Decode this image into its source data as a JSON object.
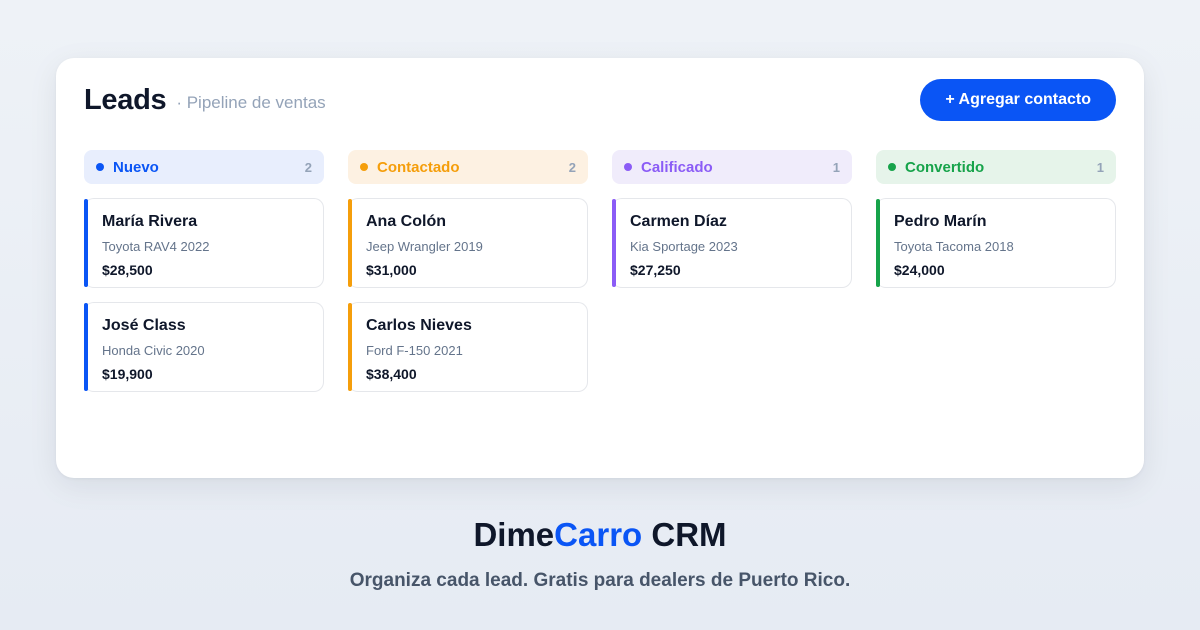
{
  "header": {
    "title": "Leads",
    "subtitle": "· Pipeline de ventas",
    "add_button_label": "+ Agregar contacto"
  },
  "columns": [
    {
      "label": "Nuevo",
      "count": "2",
      "color": "#0a55f5",
      "bg": "#e8eefd",
      "cards": [
        {
          "name": "María Rivera",
          "car": "Toyota RAV4 2022",
          "price": "$28,500"
        },
        {
          "name": "José Class",
          "car": "Honda Civic 2020",
          "price": "$19,900"
        }
      ]
    },
    {
      "label": "Contactado",
      "count": "2",
      "color": "#f59e0b",
      "bg": "#fdf1e2",
      "cards": [
        {
          "name": "Ana Colón",
          "car": "Jeep Wrangler 2019",
          "price": "$31,000"
        },
        {
          "name": "Carlos Nieves",
          "car": "Ford F-150 2021",
          "price": "$38,400"
        }
      ]
    },
    {
      "label": "Calificado",
      "count": "1",
      "color": "#8b5cf6",
      "bg": "#f0ecfb",
      "cards": [
        {
          "name": "Carmen Díaz",
          "car": "Kia Sportage 2023",
          "price": "$27,250"
        }
      ]
    },
    {
      "label": "Convertido",
      "count": "1",
      "color": "#16a34a",
      "bg": "#e6f4ea",
      "cards": [
        {
          "name": "Pedro Marín",
          "car": "Toyota Tacoma 2018",
          "price": "$24,000"
        }
      ]
    }
  ],
  "footer": {
    "brand_part1": "Dime",
    "brand_part2": "Carro",
    "brand_part3": " CRM",
    "tagline": "Organiza cada lead. Gratis para dealers de Puerto Rico."
  }
}
